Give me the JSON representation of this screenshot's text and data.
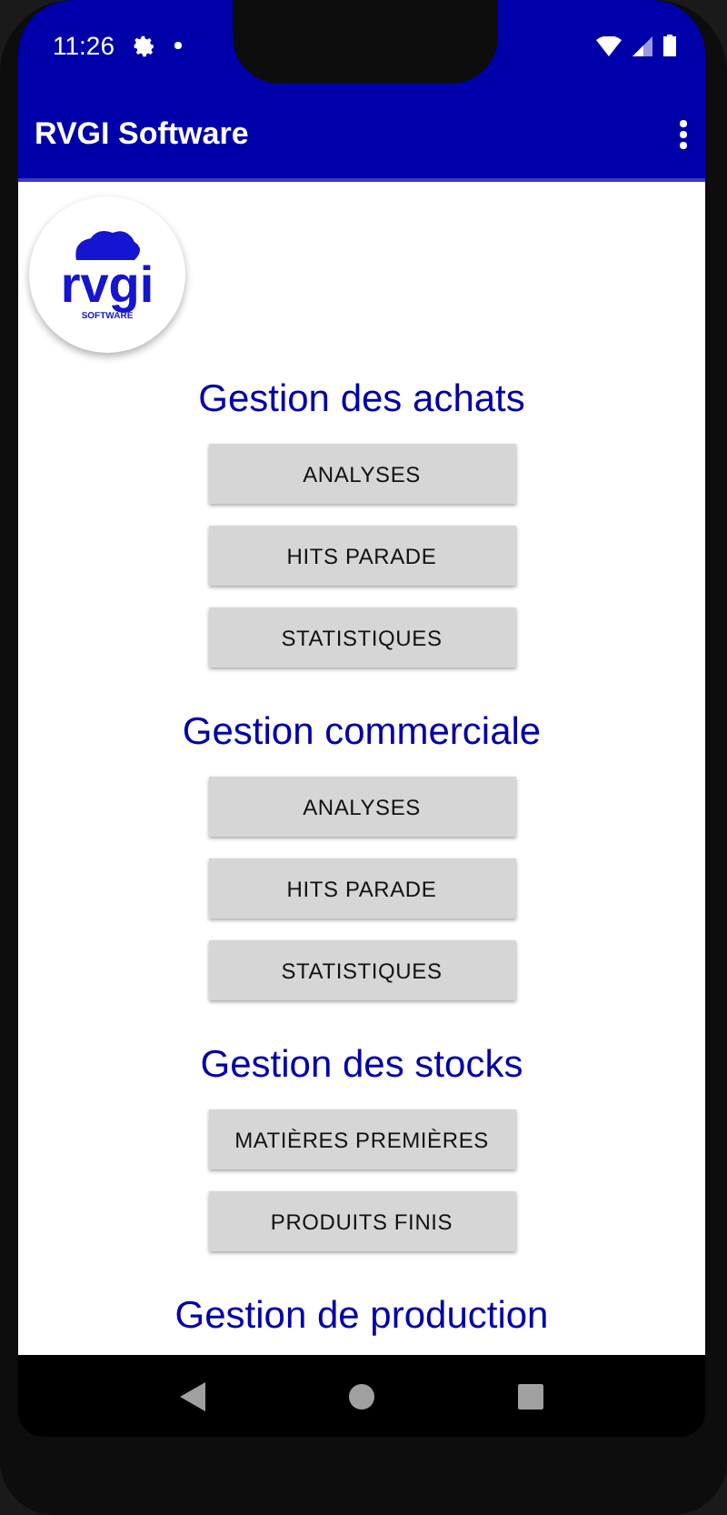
{
  "status_bar": {
    "time": "11:26"
  },
  "app_bar": {
    "title": "RVGI Software"
  },
  "logo": {
    "wordmark": "rvgi",
    "tagline": "SOFTWARE"
  },
  "sections": [
    {
      "heading": "Gestion des achats",
      "buttons": [
        "ANALYSES",
        "HITS PARADE",
        "STATISTIQUES"
      ]
    },
    {
      "heading": "Gestion commerciale",
      "buttons": [
        "ANALYSES",
        "HITS PARADE",
        "STATISTIQUES"
      ]
    },
    {
      "heading": "Gestion des stocks",
      "buttons": [
        "MATIÈRES PREMIÈRES",
        "PRODUITS FINIS"
      ]
    },
    {
      "heading": "Gestion de production"
    }
  ]
}
